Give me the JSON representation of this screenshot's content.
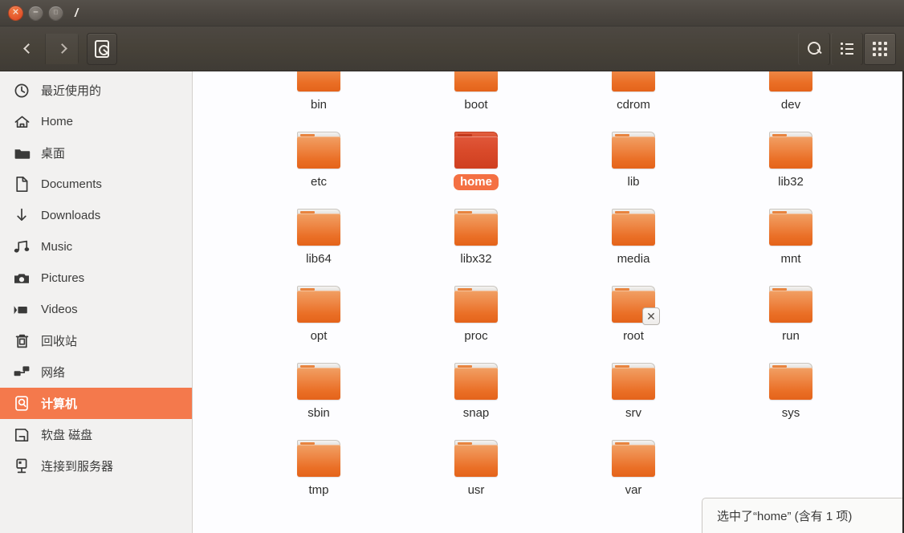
{
  "window": {
    "title": "/",
    "buttons": {
      "close": {
        "name": "close-button",
        "glyph": "✕"
      },
      "minimize": {
        "name": "minimize-button",
        "glyph": "−"
      },
      "maximize": {
        "name": "maximize-button",
        "glyph": "□"
      }
    }
  },
  "toolbar": {
    "back_label": "",
    "forward_label": "",
    "location_icon": "computer-icon",
    "search_icon": "search-icon",
    "list_view_icon": "list-view-icon",
    "grid_view_icon": "grid-view-icon",
    "active_view": "grid"
  },
  "sidebar": {
    "items": [
      {
        "label": "最近使用的",
        "icon": "clock-icon",
        "selected": false
      },
      {
        "label": "Home",
        "icon": "home-icon",
        "selected": false
      },
      {
        "label": "桌面",
        "icon": "folder-icon",
        "selected": false
      },
      {
        "label": "Documents",
        "icon": "document-icon",
        "selected": false
      },
      {
        "label": "Downloads",
        "icon": "download-arrow-icon",
        "selected": false
      },
      {
        "label": "Music",
        "icon": "music-note-icon",
        "selected": false
      },
      {
        "label": "Pictures",
        "icon": "camera-icon",
        "selected": false
      },
      {
        "label": "Videos",
        "icon": "video-camera-icon",
        "selected": false
      },
      {
        "label": "回收站",
        "icon": "trash-icon",
        "selected": false
      },
      {
        "label": "网络",
        "icon": "network-icon",
        "selected": false
      },
      {
        "label": "计算机",
        "icon": "computer-icon",
        "selected": true
      },
      {
        "label": "软盘 磁盘",
        "icon": "floppy-disk-icon",
        "selected": false
      },
      {
        "label": "连接到服务器",
        "icon": "server-connect-icon",
        "selected": false
      }
    ]
  },
  "files": {
    "items": [
      {
        "name": "bin",
        "selected": false,
        "emblem": ""
      },
      {
        "name": "boot",
        "selected": false,
        "emblem": ""
      },
      {
        "name": "cdrom",
        "selected": false,
        "emblem": ""
      },
      {
        "name": "dev",
        "selected": false,
        "emblem": ""
      },
      {
        "name": "etc",
        "selected": false,
        "emblem": ""
      },
      {
        "name": "home",
        "selected": true,
        "emblem": ""
      },
      {
        "name": "lib",
        "selected": false,
        "emblem": ""
      },
      {
        "name": "lib32",
        "selected": false,
        "emblem": ""
      },
      {
        "name": "lib64",
        "selected": false,
        "emblem": ""
      },
      {
        "name": "libx32",
        "selected": false,
        "emblem": ""
      },
      {
        "name": "media",
        "selected": false,
        "emblem": ""
      },
      {
        "name": "mnt",
        "selected": false,
        "emblem": ""
      },
      {
        "name": "opt",
        "selected": false,
        "emblem": ""
      },
      {
        "name": "proc",
        "selected": false,
        "emblem": ""
      },
      {
        "name": "root",
        "selected": false,
        "emblem": "✕"
      },
      {
        "name": "run",
        "selected": false,
        "emblem": ""
      },
      {
        "name": "sbin",
        "selected": false,
        "emblem": ""
      },
      {
        "name": "snap",
        "selected": false,
        "emblem": ""
      },
      {
        "name": "srv",
        "selected": false,
        "emblem": ""
      },
      {
        "name": "sys",
        "selected": false,
        "emblem": ""
      },
      {
        "name": "tmp",
        "selected": false,
        "emblem": ""
      },
      {
        "name": "usr",
        "selected": false,
        "emblem": ""
      },
      {
        "name": "var",
        "selected": false,
        "emblem": ""
      }
    ]
  },
  "statusbar": {
    "text": "选中了“home” (含有 1 项)"
  },
  "colors": {
    "titlebar_dark": "#443f3a",
    "selection_orange": "#f4794c",
    "folder_orange": "#ea6f26",
    "selected_folder": "#d94a2a",
    "sidebar_bg": "#f2f1f0",
    "file_area_bg": "#fdfdff"
  }
}
